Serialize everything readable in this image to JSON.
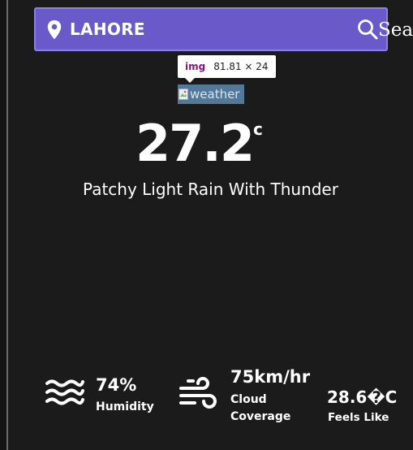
{
  "search": {
    "city_value": "LAHORE",
    "button_text": "Search"
  },
  "devtools_tooltip": {
    "tag": "img",
    "size": "81.81 × 24"
  },
  "weather_image": {
    "alt": "weather"
  },
  "current": {
    "temperature": "27.2",
    "unit": "c",
    "condition": "Patchy Light Rain With Thunder"
  },
  "details": {
    "humidity": {
      "value": "74%",
      "label": "Humidity"
    },
    "wind": {
      "value": "75km/hr",
      "label": "Cloud Coverage"
    },
    "feels_like": {
      "value": "28.6�C",
      "label": "Feels Like"
    }
  },
  "colors": {
    "background": "#1c1b1b",
    "search_bar": "#6a59c8",
    "text": "#ffffff",
    "devtools_highlight": "#6fa8dc"
  },
  "icons": {
    "location": "map-pin-icon",
    "search": "magnifier-icon",
    "humidity": "waves-icon",
    "wind": "wind-icon",
    "broken_image": "broken-image-icon"
  }
}
